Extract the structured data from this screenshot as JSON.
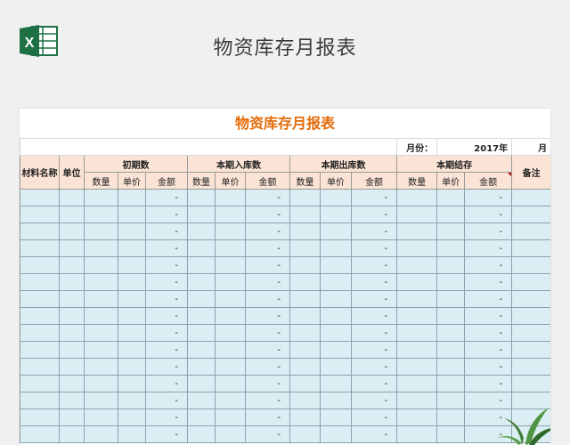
{
  "banner_title": "物资库存月报表",
  "sheet": {
    "title": "物资库存月报表",
    "title_color": "#e46c0a",
    "month_label": "月份：",
    "year_value": "2017年",
    "month_suffix": "月",
    "headers": {
      "material_name": "材料名称",
      "unit": "单位",
      "groups": [
        "初期数",
        "本期入库数",
        "本期出库数",
        "本期结存"
      ],
      "remark": "备注",
      "sub": [
        "数量",
        "单价",
        "金额"
      ]
    },
    "dash": "-",
    "row_count": 15
  },
  "colors": {
    "excel_green": "#1e7145",
    "header_fill": "#fbe4d5",
    "data_fill": "#dbeef3"
  },
  "icons": {
    "logo": "excel-icon",
    "plant": "plant-icon"
  }
}
